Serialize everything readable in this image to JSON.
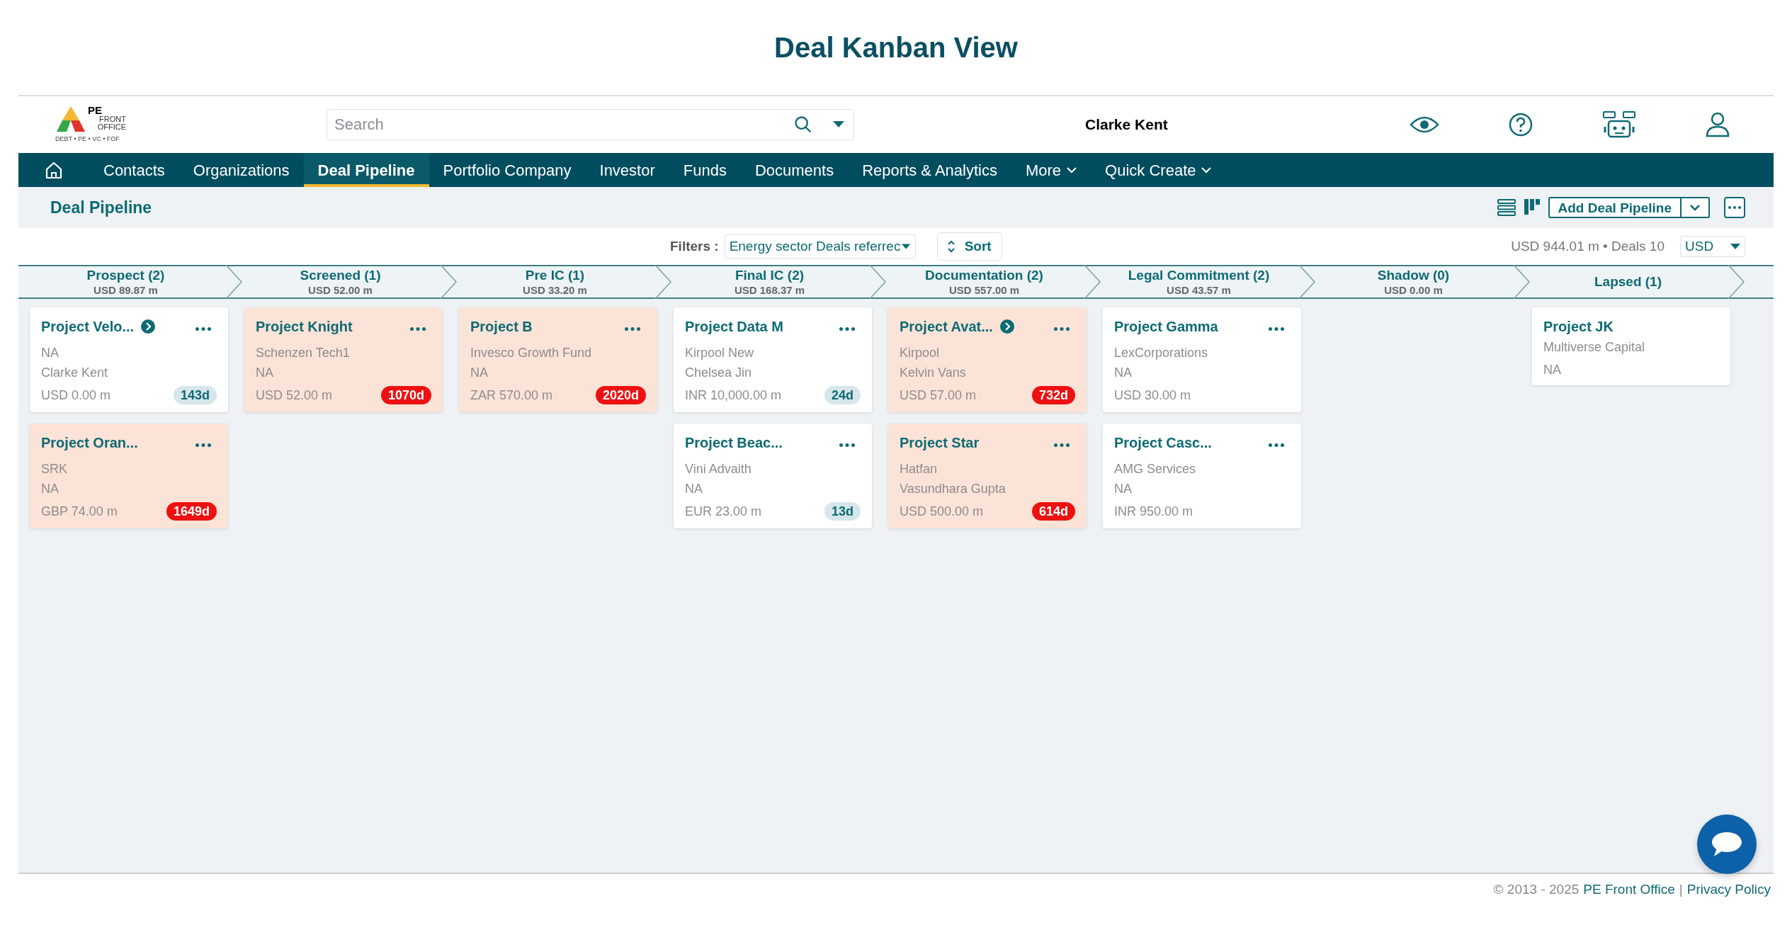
{
  "page_title": "Deal Kanban View",
  "header": {
    "logo": {
      "mark": "PE",
      "name": "FRONT OFFICE",
      "tagline": "DEBT • PE • VC • FOF"
    },
    "search": {
      "placeholder": "Search"
    },
    "user_name": "Clarke Kent"
  },
  "nav": [
    {
      "label": "Contacts",
      "selected": false,
      "has_menu": false
    },
    {
      "label": "Organizations",
      "selected": false,
      "has_menu": false
    },
    {
      "label": "Deal Pipeline",
      "selected": true,
      "has_menu": false
    },
    {
      "label": "Portfolio Company",
      "selected": false,
      "has_menu": false
    },
    {
      "label": "Investor",
      "selected": false,
      "has_menu": false
    },
    {
      "label": "Funds",
      "selected": false,
      "has_menu": false
    },
    {
      "label": "Documents",
      "selected": false,
      "has_menu": false
    },
    {
      "label": "Reports & Analytics",
      "selected": false,
      "has_menu": false
    },
    {
      "label": "More",
      "selected": false,
      "has_menu": true
    },
    {
      "label": "Quick Create",
      "selected": false,
      "has_menu": true
    }
  ],
  "toolbar": {
    "title": "Deal Pipeline",
    "add_button": "Add Deal Pipeline"
  },
  "filter_bar": {
    "filters_label": "Filters :",
    "filter_value": "Energy sector Deals referrec",
    "sort_label": "Sort",
    "summary": "USD 944.01 m • Deals 10",
    "currency": "USD"
  },
  "stages": [
    {
      "name": "Prospect (2)",
      "amount": "USD 89.87 m",
      "cards": [
        {
          "title": "Project Velo...",
          "arrow": true,
          "menu": true,
          "highlighted": false,
          "lines": [
            "NA",
            "Clarke Kent"
          ],
          "amount": "USD 0.00 m",
          "age": "143d",
          "overdue": false
        },
        {
          "title": "Project Oran...",
          "arrow": false,
          "menu": true,
          "highlighted": true,
          "lines": [
            "SRK",
            "NA"
          ],
          "amount": "GBP 74.00 m",
          "age": "1649d",
          "overdue": true
        }
      ]
    },
    {
      "name": "Screened (1)",
      "amount": "USD 52.00 m",
      "cards": [
        {
          "title": "Project Knight",
          "arrow": false,
          "menu": true,
          "highlighted": true,
          "lines": [
            "Schenzen Tech1",
            "NA"
          ],
          "amount": "USD 52.00 m",
          "age": "1070d",
          "overdue": true
        }
      ]
    },
    {
      "name": "Pre IC (1)",
      "amount": "USD 33.20 m",
      "cards": [
        {
          "title": "Project B",
          "arrow": false,
          "menu": true,
          "highlighted": true,
          "lines": [
            "Invesco Growth Fund",
            "NA"
          ],
          "amount": "ZAR 570.00 m",
          "age": "2020d",
          "overdue": true
        }
      ]
    },
    {
      "name": "Final IC (2)",
      "amount": "USD 168.37 m",
      "cards": [
        {
          "title": "Project Data M",
          "arrow": false,
          "menu": true,
          "highlighted": false,
          "lines": [
            "Kirpool New",
            "Chelsea Jin"
          ],
          "amount": "INR 10,000.00 m",
          "age": "24d",
          "overdue": false
        },
        {
          "title": "Project Beac...",
          "arrow": false,
          "menu": true,
          "highlighted": false,
          "lines": [
            "Vini Advaith",
            "NA"
          ],
          "amount": "EUR 23.00 m",
          "age": "13d",
          "overdue": false
        }
      ]
    },
    {
      "name": "Documentation (2)",
      "amount": "USD 557.00 m",
      "cards": [
        {
          "title": "Project Avat...",
          "arrow": true,
          "menu": true,
          "highlighted": true,
          "lines": [
            "Kirpool",
            "Kelvin Vans"
          ],
          "amount": "USD 57.00 m",
          "age": "732d",
          "overdue": true
        },
        {
          "title": "Project Star",
          "arrow": false,
          "menu": true,
          "highlighted": true,
          "lines": [
            "Hatfan",
            "Vasundhara Gupta"
          ],
          "amount": "USD 500.00 m",
          "age": "614d",
          "overdue": true
        }
      ]
    },
    {
      "name": "Legal Commitment (2)",
      "amount": "USD 43.57 m",
      "cards": [
        {
          "title": "Project Gamma",
          "arrow": false,
          "menu": true,
          "highlighted": false,
          "lines": [
            "LexCorporations",
            "NA"
          ],
          "amount": "USD 30.00 m"
        },
        {
          "title": "Project Casc...",
          "arrow": false,
          "menu": true,
          "highlighted": false,
          "lines": [
            "AMG Services",
            "NA"
          ],
          "amount": "INR 950.00 m"
        }
      ]
    },
    {
      "name": "Shadow (0)",
      "amount": "USD 0.00 m"
    },
    {
      "name": "Lapsed (1)",
      "cards": [
        {
          "title": "Project JK",
          "arrow": false,
          "menu": false,
          "highlighted": false,
          "lines": [
            "Multiverse Capital",
            "NA"
          ]
        }
      ]
    }
  ],
  "footer": {
    "copyright": "© 2013 - 2025",
    "company_link": "PE Front Office",
    "separator": "|",
    "privacy_link": "Privacy Policy"
  }
}
